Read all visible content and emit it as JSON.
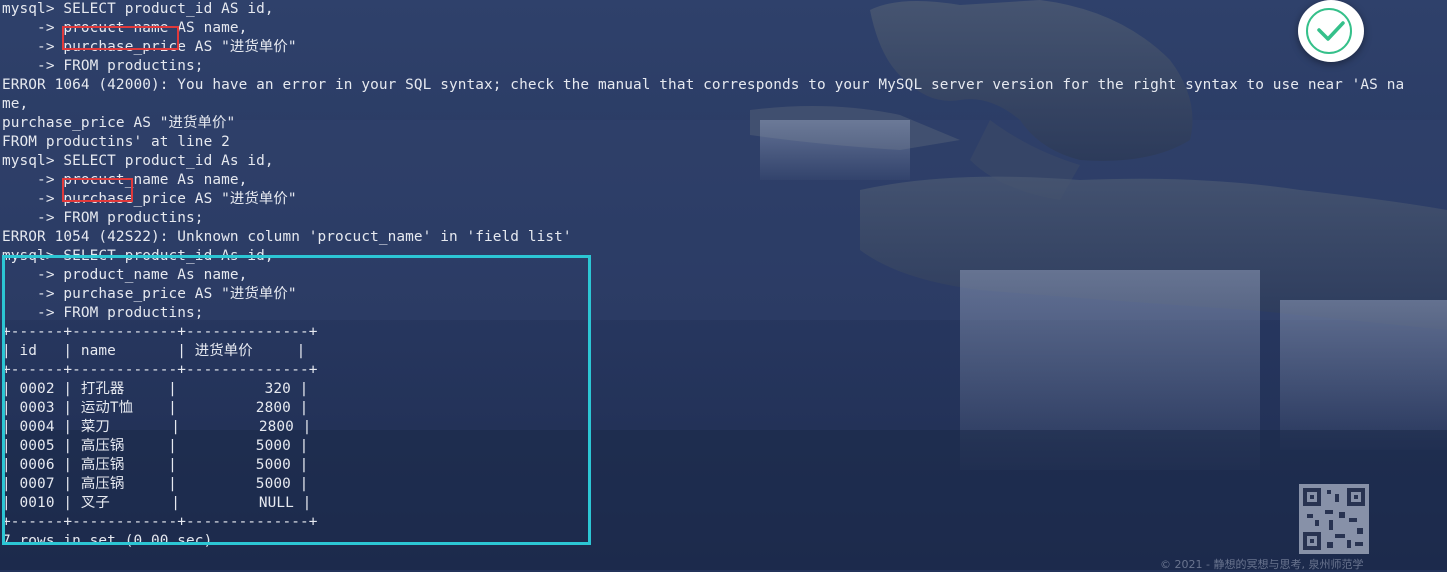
{
  "terminal": {
    "lines": [
      "mysql> SELECT product_id AS id,",
      "    -> procuct name AS name,",
      "    -> purchase_price AS \"进货单价\"",
      "    -> FROM productins;",
      "ERROR 1064 (42000): You have an error in your SQL syntax; check the manual that corresponds to your MySQL server version for the right syntax to use near 'AS na",
      "me,",
      "purchase_price AS \"进货单价\"",
      "FROM productins' at line 2",
      "mysql> SELECT product_id As id,",
      "    -> procuct_name As name,",
      "    -> purchase_price AS \"进货单价\"",
      "    -> FROM productins;",
      "ERROR 1054 (42S22): Unknown column 'procuct_name' in 'field list'",
      "mysql> SELECT product_id As id,",
      "    -> product_name As name,",
      "    -> purchase_price AS \"进货单价\"",
      "    -> FROM productins;",
      "+------+------------+--------------+",
      "| id   | name       | 进货单价     |",
      "+------+------------+--------------+",
      "| 0002 | 打孔器     |          320 |",
      "| 0003 | 运动T恤    |         2800 |",
      "| 0004 | 菜刀       |         2800 |",
      "| 0005 | 高压锅     |         5000 |",
      "| 0006 | 高压锅     |         5000 |",
      "| 0007 | 高压锅     |         5000 |",
      "| 0010 | 叉子       |         NULL |",
      "+------+------------+--------------+",
      "7 rows in set (0.00 sec)"
    ]
  },
  "icons": {
    "check_badge": "check-circle-icon",
    "qr": "qr-code-icon"
  },
  "watermark": "© 2021 - 静想的冥想与思考, 泉州师范学",
  "colors": {
    "terminal_text": "#e6e9f0",
    "highlight_red": "#e0393b",
    "highlight_cyan": "#2cc6d4",
    "check_green": "#35c08a",
    "background": "#23335a"
  }
}
